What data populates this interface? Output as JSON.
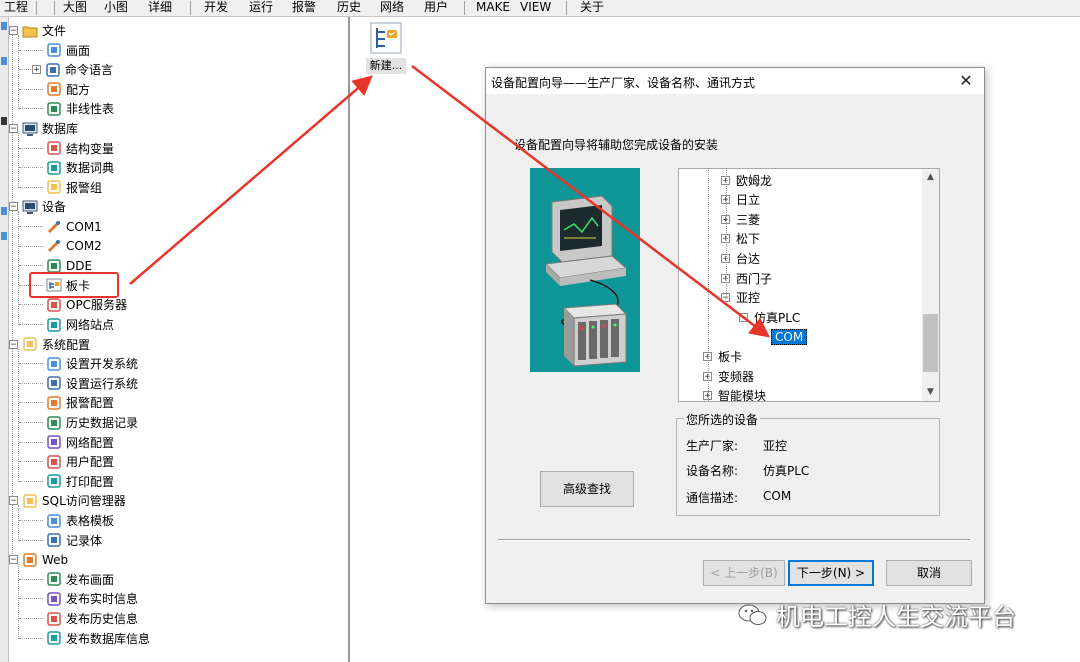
{
  "menu": {
    "items": [
      "工程",
      "大图",
      "小图",
      "详细",
      "开发",
      "运行",
      "报警",
      "历史",
      "网络",
      "用户",
      "MAKE",
      "VIEW",
      "关于"
    ]
  },
  "project_tree": {
    "nodes": [
      {
        "label": "文件",
        "icon": "folder-icon",
        "expander": "−"
      },
      {
        "label": "画面",
        "icon": "screen-icon"
      },
      {
        "label": "命令语言",
        "icon": "command-language-icon",
        "expander": "+"
      },
      {
        "label": "配方",
        "icon": "recipe-icon"
      },
      {
        "label": "非线性表",
        "icon": "nonlinear-table-icon"
      },
      {
        "label": "数据库",
        "icon": "database-icon",
        "expander": "−"
      },
      {
        "label": "结构变量",
        "icon": "struct-variable-icon"
      },
      {
        "label": "数据词典",
        "icon": "data-dictionary-icon"
      },
      {
        "label": "报警组",
        "icon": "alarm-group-icon"
      },
      {
        "label": "设备",
        "icon": "device-monitor-icon",
        "expander": "−"
      },
      {
        "label": "COM1",
        "icon": "com-port-icon"
      },
      {
        "label": "COM2",
        "icon": "com-port-icon"
      },
      {
        "label": "DDE",
        "icon": "dde-icon"
      },
      {
        "label": "板卡",
        "icon": "board-card-icon"
      },
      {
        "label": "OPC服务器",
        "icon": "opc-server-icon"
      },
      {
        "label": "网络站点",
        "icon": "network-station-icon"
      },
      {
        "label": "系统配置",
        "icon": "system-config-icon",
        "expander": "−"
      },
      {
        "label": "设置开发系统",
        "icon": "dev-settings-icon"
      },
      {
        "label": "设置运行系统",
        "icon": "run-settings-icon"
      },
      {
        "label": "报警配置",
        "icon": "alarm-config-icon"
      },
      {
        "label": "历史数据记录",
        "icon": "history-record-icon"
      },
      {
        "label": "网络配置",
        "icon": "network-config-icon"
      },
      {
        "label": "用户配置",
        "icon": "user-config-icon"
      },
      {
        "label": "打印配置",
        "icon": "print-config-icon"
      },
      {
        "label": "SQL访问管理器",
        "icon": "sql-manager-icon",
        "expander": "−"
      },
      {
        "label": "表格模板",
        "icon": "table-template-icon"
      },
      {
        "label": "记录体",
        "icon": "record-body-icon"
      },
      {
        "label": "Web",
        "icon": "web-icon",
        "expander": "−"
      },
      {
        "label": "发布画面",
        "icon": "publish-screen-icon"
      },
      {
        "label": "发布实时信息",
        "icon": "publish-realtime-icon"
      },
      {
        "label": "发布历史信息",
        "icon": "publish-history-icon"
      },
      {
        "label": "发布数据库信息",
        "icon": "publish-database-icon"
      }
    ]
  },
  "workspace": {
    "new_item_label": "新建..."
  },
  "dialog": {
    "title": "设备配置向导——生产厂家、设备名称、通讯方式",
    "description": "设备配置向导将辅助您完成设备的安装",
    "device_tree": [
      {
        "label": "欧姆龙",
        "expander": "+"
      },
      {
        "label": "日立",
        "expander": "+"
      },
      {
        "label": "三菱",
        "expander": "+"
      },
      {
        "label": "松下",
        "expander": "+"
      },
      {
        "label": "台达",
        "expander": "+"
      },
      {
        "label": "西门子",
        "expander": "+"
      },
      {
        "label": "亚控",
        "expander": "−"
      },
      {
        "label": "仿真PLC",
        "expander": "−"
      },
      {
        "label": "COM",
        "selected": true
      },
      {
        "label": "板卡",
        "expander": "+"
      },
      {
        "label": "变频器",
        "expander": "+"
      },
      {
        "label": "智能模块",
        "expander": "+"
      }
    ],
    "selected_group": {
      "title": "您所选的设备",
      "rows": [
        {
          "label": "生产厂家:",
          "value": "亚控"
        },
        {
          "label": "设备名称:",
          "value": "仿真PLC"
        },
        {
          "label": "通信描述:",
          "value": "COM"
        }
      ]
    },
    "buttons": {
      "advanced_search": "高级查找",
      "prev": "< 上一步(B)",
      "next": "下一步(N) >",
      "cancel": "取消"
    }
  },
  "watermark": {
    "text": "机电工控人生交流平台"
  },
  "colors": {
    "annotation_red": "#e8342a",
    "selection_blue": "#0078d7",
    "illustration_teal": "#0e9696"
  }
}
